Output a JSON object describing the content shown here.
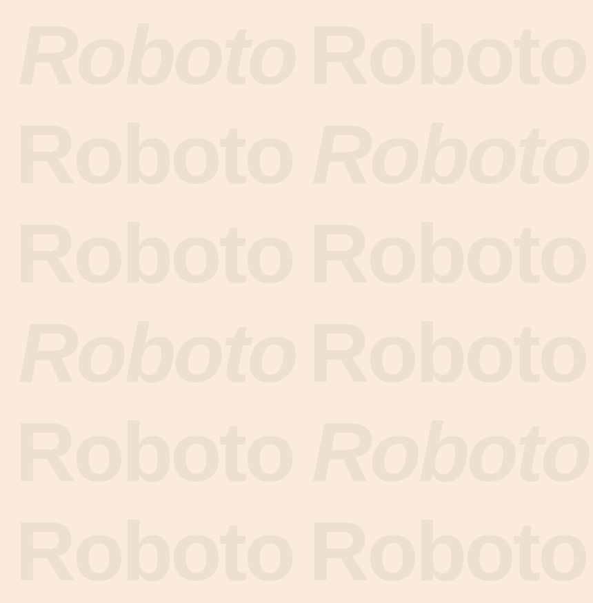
{
  "pattern": {
    "background_color": "#faebdc",
    "text_color": "#ede0d2",
    "rows": [
      {
        "words": [
          {
            "text": "Roboto",
            "style": "italic"
          },
          {
            "text": "Roboto",
            "style": "regular"
          }
        ]
      },
      {
        "words": [
          {
            "text": "Roboto",
            "style": "regular"
          },
          {
            "text": "Roboto",
            "style": "italic"
          }
        ]
      },
      {
        "words": [
          {
            "text": "Roboto",
            "style": "regular"
          },
          {
            "text": "Roboto",
            "style": "regular"
          }
        ]
      },
      {
        "words": [
          {
            "text": "Roboto",
            "style": "italic"
          },
          {
            "text": "Roboto",
            "style": "regular"
          }
        ]
      },
      {
        "words": [
          {
            "text": "Roboto",
            "style": "regular"
          },
          {
            "text": "Roboto",
            "style": "italic"
          }
        ]
      },
      {
        "words": [
          {
            "text": "Roboto",
            "style": "regular"
          },
          {
            "text": "Roboto",
            "style": "regular"
          }
        ]
      }
    ]
  }
}
